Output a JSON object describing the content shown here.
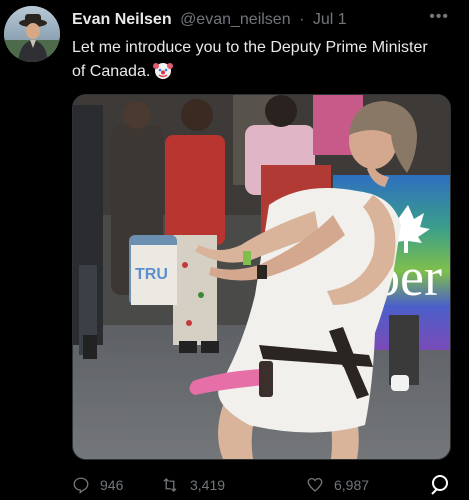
{
  "author": {
    "display_name": "Evan Neilsen",
    "handle": "@evan_neilsen",
    "separator": "·",
    "date": "Jul 1"
  },
  "tweet": {
    "text": "Let me introduce you to the Deputy Prime Minister of Canada.",
    "emoji_icon": "clown-face-icon"
  },
  "media": {
    "banner_text_left": "TRU",
    "banner_text_right": "ber"
  },
  "actions": {
    "replies": "946",
    "retweets": "3,419",
    "likes": "6,987"
  },
  "colors": {
    "background": "#000000",
    "text": "#e7e9ea",
    "muted": "#71767b",
    "border": "#2f3336"
  }
}
